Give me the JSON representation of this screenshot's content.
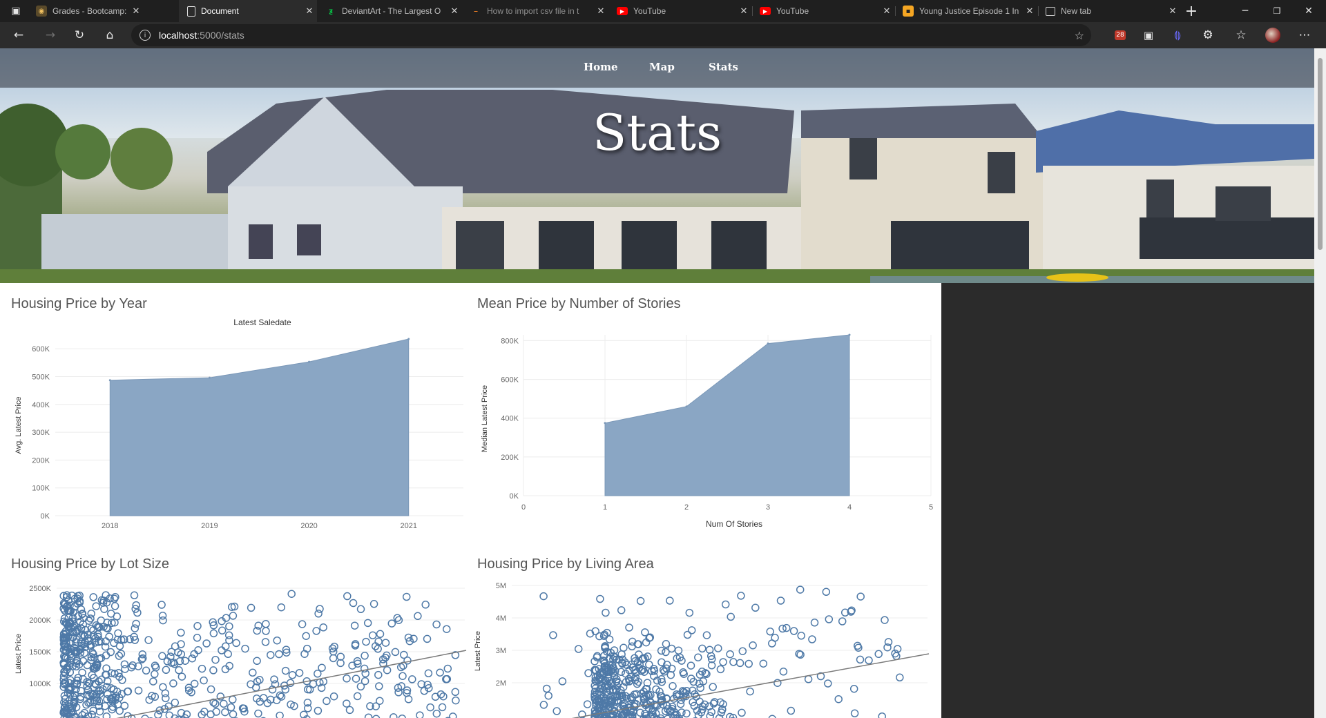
{
  "browser": {
    "tabs": [
      {
        "title": "Grades - Bootcamp: UCB-",
        "active": false
      },
      {
        "title": "Document",
        "active": true
      },
      {
        "title": "DeviantArt - The Largest O",
        "active": false
      },
      {
        "title": "How to import csv file in t",
        "active": false
      },
      {
        "title": "YouTube",
        "active": false
      },
      {
        "title": "YouTube",
        "active": false
      },
      {
        "title": "Young Justice Episode 1 In",
        "active": false
      },
      {
        "title": "New tab",
        "active": false
      }
    ],
    "new_tab": "+",
    "url_host": "localhost",
    "url_path": ":5000/stats",
    "extension_badge": "28"
  },
  "site": {
    "nav": [
      "Home",
      "Map",
      "Stats"
    ],
    "hero_title": "Stats"
  },
  "chart_data": [
    {
      "type": "area",
      "title": "Housing Price by Year",
      "subtitle": "Latest Saledate",
      "xlabel": "",
      "ylabel": "Avg. Latest Price",
      "x": [
        2018,
        2019,
        2020,
        2021
      ],
      "y": [
        487000,
        496000,
        553000,
        635000
      ],
      "ylim": [
        0,
        650000
      ],
      "yticks": [
        "0K",
        "100K",
        "200K",
        "300K",
        "400K",
        "500K",
        "600K"
      ],
      "color": "#8aa6c4"
    },
    {
      "type": "area",
      "title": "Mean Price by Number of Stories",
      "xlabel": "Num Of Stories",
      "ylabel": "Median Latest Price",
      "x": [
        1,
        2,
        3,
        4
      ],
      "y": [
        375000,
        460000,
        785000,
        830000
      ],
      "xlim": [
        0,
        5
      ],
      "ylim": [
        0,
        830000
      ],
      "yticks": [
        "0K",
        "200K",
        "400K",
        "600K",
        "800K"
      ],
      "color": "#8aa6c4"
    },
    {
      "type": "scatter",
      "title": "Housing Price by Lot Size",
      "ylabel": "Latest Price",
      "yticks": [
        "1000K",
        "1500K",
        "2000K",
        "2500K"
      ],
      "color": "#4e79a7"
    },
    {
      "type": "scatter",
      "title": "Housing Price by Living Area",
      "ylabel": "Latest Price",
      "yticks": [
        "2M",
        "3M",
        "4M",
        "5M"
      ],
      "color": "#4e79a7"
    }
  ]
}
